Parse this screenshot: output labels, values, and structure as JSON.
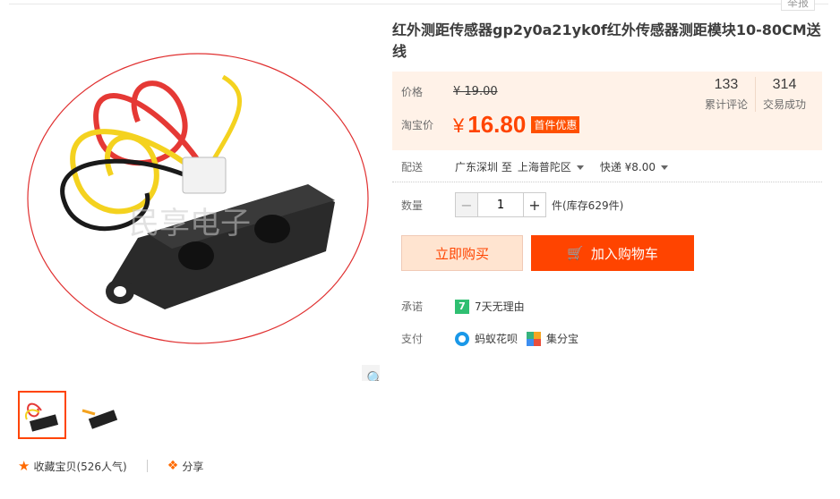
{
  "report_label": "举报",
  "product": {
    "title": "红外测距传感器gp2y0a21yk0f红外传感器测距模块10-80CM送线"
  },
  "price": {
    "orig_label": "价格",
    "orig_value": "¥ 19.00",
    "taobao_label": "淘宝价",
    "currency": "¥",
    "current_value": "16.80",
    "promo_tag": "首件优惠"
  },
  "stats": [
    {
      "num": "133",
      "label": "累计评论"
    },
    {
      "num": "314",
      "label": "交易成功"
    }
  ],
  "delivery": {
    "label": "配送",
    "from": "广东深圳 至",
    "to": "上海普陀区",
    "shipping": "快递 ¥8.00"
  },
  "quantity": {
    "label": "数量",
    "value": "1",
    "minus": "−",
    "plus": "+",
    "stock": "件(库存629件)"
  },
  "actions": {
    "buy_now": "立即购买",
    "add_to_cart": "加入购物车"
  },
  "promise": {
    "label": "承诺",
    "badge": "7",
    "text": "7天无理由"
  },
  "payment": {
    "label": "支付",
    "huabei": "蚂蚁花呗",
    "jifenbao": "集分宝"
  },
  "watermark": "民享电子",
  "social": {
    "favorite": "收藏宝贝",
    "popularity": "(526人气)",
    "share": "分享"
  },
  "colors": {
    "accent": "#ff4400",
    "price_bg": "#fff2e8",
    "buy_bg": "#ffe4d0"
  }
}
